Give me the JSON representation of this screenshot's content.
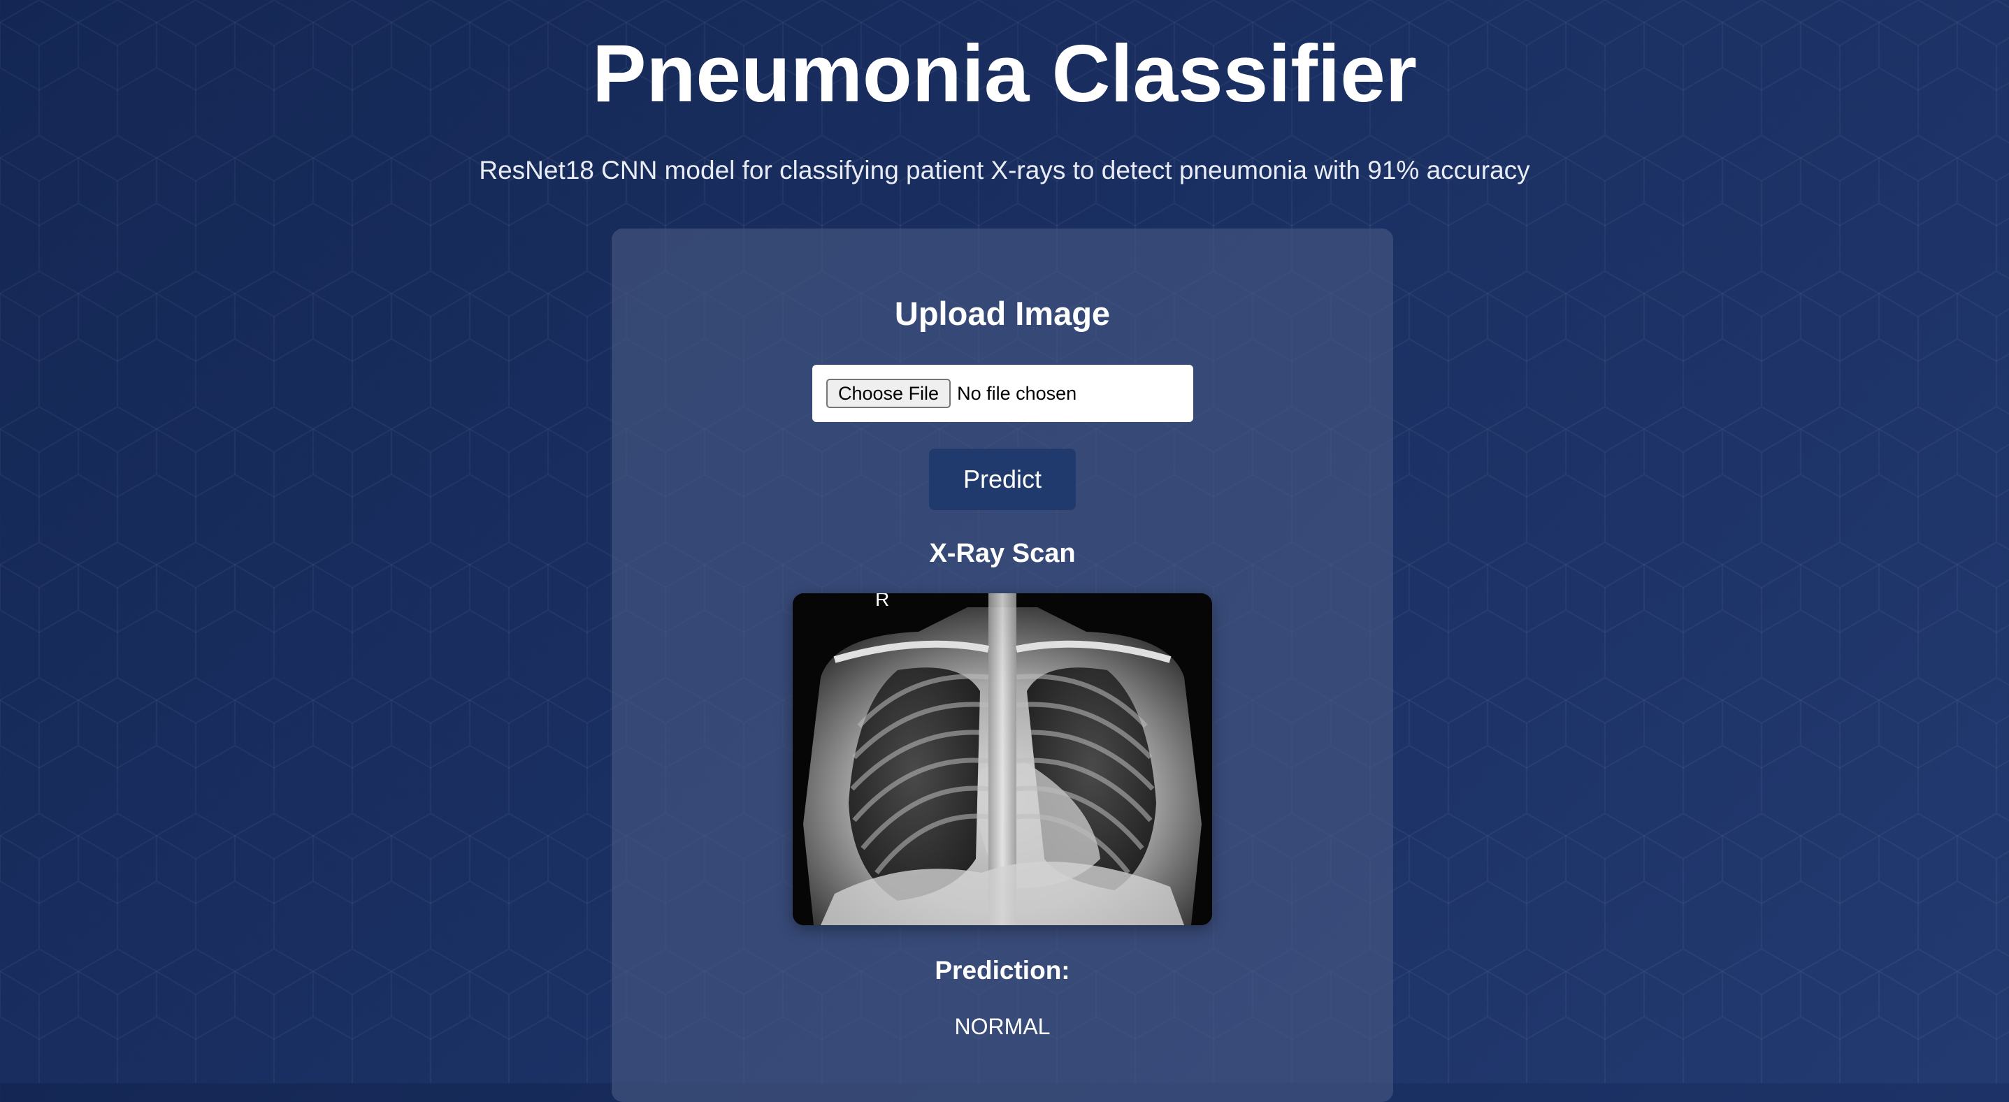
{
  "header": {
    "title": "Pneumonia Classifier",
    "subtitle": "ResNet18 CNN model for classifying patient X-rays to detect pneumonia with 91% accuracy"
  },
  "upload": {
    "heading": "Upload Image",
    "choose_file_label": "Choose File",
    "file_status": "No file chosen",
    "predict_label": "Predict"
  },
  "scan": {
    "heading": "X-Ray Scan",
    "marker": "R"
  },
  "result": {
    "heading": "Prediction:",
    "value": "NORMAL"
  },
  "colors": {
    "background": "#1b3063",
    "card": "#3c4b78",
    "predict_button": "#213a6e"
  }
}
